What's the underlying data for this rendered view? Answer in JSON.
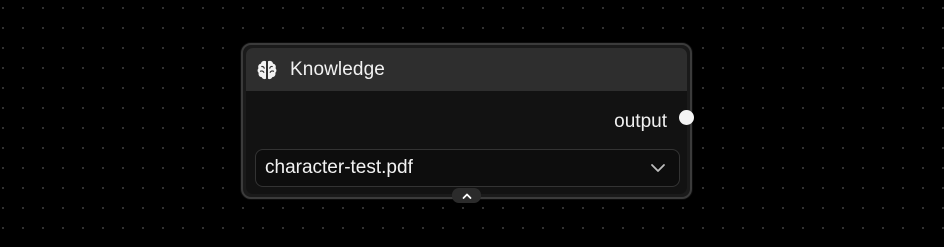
{
  "node": {
    "title": "Knowledge",
    "icon": "brain-icon",
    "output_label": "output",
    "select": {
      "value": "character-test.pdf",
      "icon": "chevron-down-icon"
    },
    "collapse_icon": "chevron-up-icon"
  },
  "colors": {
    "background": "#000000",
    "grid_dot": "#3a3a3a",
    "node_border": "#3b3b3b",
    "node_header": "#2e2e2e",
    "node_body": "#121212",
    "text": "#f2f2f2"
  }
}
